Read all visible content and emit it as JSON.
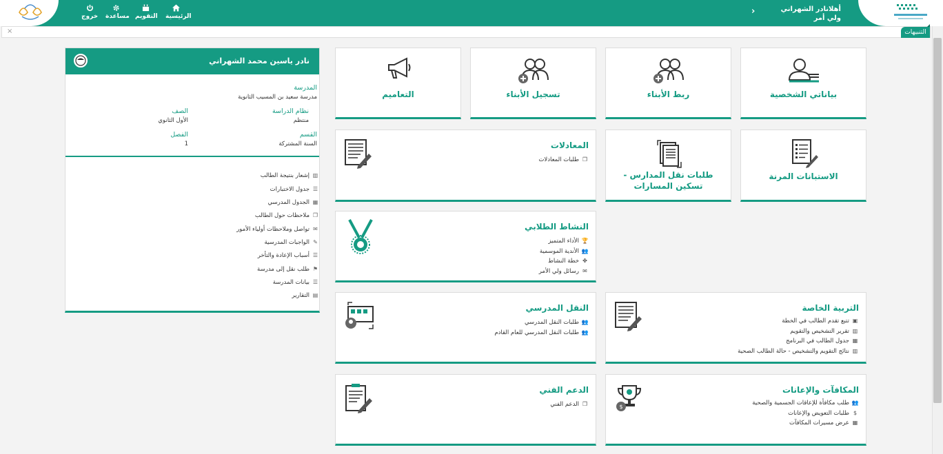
{
  "nav": {
    "logout": "خروج",
    "help": "مساعدة",
    "calendar": "التقويم",
    "home": "الرئيسية"
  },
  "user": {
    "greeting": "أهلانادر الشهراني",
    "role": "ولي أمر"
  },
  "alerts": {
    "label": "التنبيهات",
    "close": "×"
  },
  "tiles": {
    "personal": "بياناتي الشخصية",
    "link_children": "ربط الأبناء",
    "register_children": "تسجيل الأبناء",
    "circulars": "التعاميم",
    "surveys": "الاستبانات المرنة",
    "transfer": "طلبات نقل المدارس - تسكين المسارات",
    "equivalency": {
      "title": "المعادلات",
      "items": [
        "طلبات المعادلات"
      ]
    },
    "activity": {
      "title": "النشاط الطلابي",
      "items": [
        "الأداء المتميز",
        "الأندية الموسمية",
        "خطة النشاط",
        "رسائل ولي الأمر"
      ]
    },
    "special_ed": {
      "title": "التربية الخاصة",
      "items": [
        "تتبع تقدم الطالب في الخطة",
        "تقرير التشخيص والتقويم",
        "جدول الطالب في البرنامج",
        "نتائج التقويم والتشخيص - حالة الطالب الصحية"
      ]
    },
    "transport": {
      "title": "النقل المدرسي",
      "items": [
        "طلبات النقل المدرسي",
        "طلبات النقل المدرسي للعام القادم"
      ]
    },
    "rewards": {
      "title": "المكافآت والإعانات",
      "items": [
        "طلب مكافأة للإعاقات الجسمية والصحية",
        "طلبات التعويض والإعانات",
        "عرض مسيرات المكافآت"
      ]
    },
    "support": {
      "title": "الدعم الفني",
      "items": [
        "الدعم الفني"
      ]
    }
  },
  "student": {
    "name": "نادر ياسين محمد الشهراني",
    "school_label": "المدرسة",
    "school": "مدرسة سعيد بن المسيب الثانوية",
    "system_label": "نظام الدراسة",
    "system": "منتظم",
    "grade_label": "الصف",
    "grade": "الأول الثانوي",
    "dept_label": "القسم",
    "dept": "السنة المشتركة",
    "class_label": "الفصل",
    "class": "1"
  },
  "student_links": [
    "إشعار بنتيجة الطالب",
    "جدول الاختبارات",
    "الجدول المدرسي",
    "ملاحظات حول الطالب",
    "تواصل وملاحظات أولياء الأمور",
    "الواجبات المدرسية",
    "أسباب الإعادة والتأخر",
    "طلب نقل إلى مدرسة",
    "بيانات المدرسة",
    "التقارير"
  ],
  "colors": {
    "accent": "#159b83"
  }
}
